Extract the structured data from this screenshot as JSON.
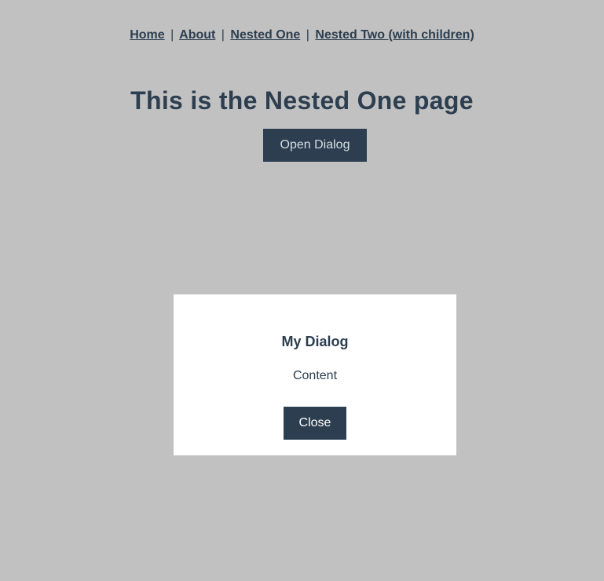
{
  "nav": {
    "links": [
      {
        "label": "Home"
      },
      {
        "label": "About"
      },
      {
        "label": "Nested One"
      },
      {
        "label": "Nested Two (with children)"
      }
    ],
    "separator": "|"
  },
  "page": {
    "title": "This is the Nested One page",
    "open_dialog_label": "Open Dialog"
  },
  "dialog": {
    "title": "My Dialog",
    "content": "Content",
    "close_label": "Close"
  },
  "colors": {
    "background": "#c1c1c1",
    "primary": "#2c3e50",
    "dialog_background": "#ffffff"
  }
}
